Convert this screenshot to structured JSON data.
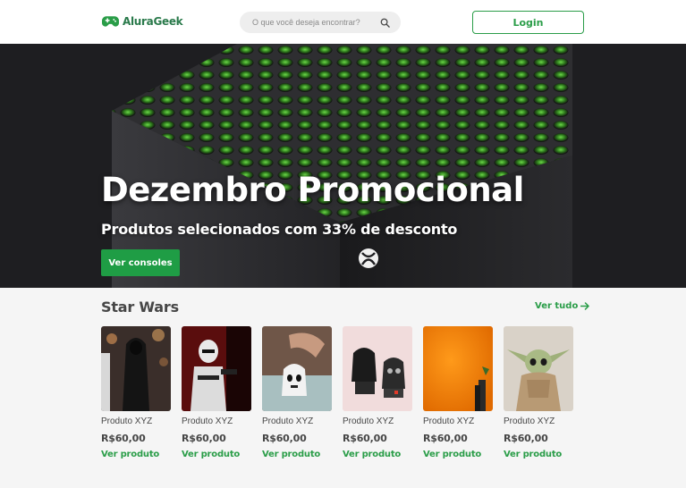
{
  "header": {
    "logo_text": "AluraGeek",
    "logo_icon": "gamepad-icon",
    "search_placeholder": "O que você deseja encontrar?",
    "search_icon": "search-icon",
    "login_label": "Login"
  },
  "banner": {
    "title": "Dezembro Promocional",
    "subtitle": "Produtos selecionados com 33% de desconto",
    "button_label": "Ver consoles"
  },
  "section": {
    "title": "Star Wars",
    "see_all_label": "Ver tudo",
    "products": [
      {
        "name": "Produto XYZ",
        "price": "R$60,00",
        "link": "Ver produto"
      },
      {
        "name": "Produto XYZ",
        "price": "R$60,00",
        "link": "Ver produto"
      },
      {
        "name": "Produto XYZ",
        "price": "R$60,00",
        "link": "Ver produto"
      },
      {
        "name": "Produto XYZ",
        "price": "R$60,00",
        "link": "Ver produto"
      },
      {
        "name": "Produto XYZ",
        "price": "R$60,00",
        "link": "Ver produto"
      },
      {
        "name": "Produto XYZ",
        "price": "R$60,00",
        "link": "Ver produto"
      }
    ]
  },
  "colors": {
    "brand_green": "#2a9d48",
    "banner_bg": "#1e1e21",
    "text": "#464646"
  }
}
